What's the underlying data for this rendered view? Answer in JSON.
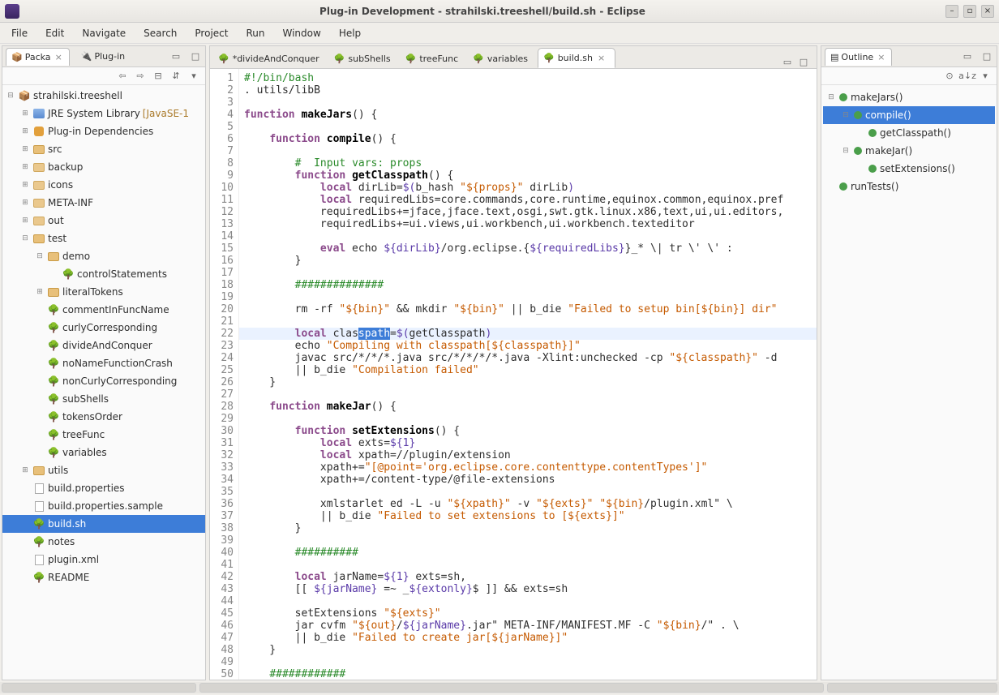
{
  "window": {
    "title": "Plug-in Development - strahilski.treeshell/build.sh - Eclipse"
  },
  "menu": [
    "File",
    "Edit",
    "Navigate",
    "Search",
    "Project",
    "Run",
    "Window",
    "Help"
  ],
  "leftTabs": [
    {
      "label": "Packa",
      "close": true
    },
    {
      "label": "Plug-in"
    }
  ],
  "project": {
    "name": "strahilski.treeshell",
    "nodes": [
      {
        "ind": 1,
        "tw": "⊞",
        "icon": "jre",
        "label": "JRE System Library",
        "suffix": "[JavaSE-1"
      },
      {
        "ind": 1,
        "tw": "⊞",
        "icon": "plug",
        "label": "Plug-in Dependencies"
      },
      {
        "ind": 1,
        "tw": "⊞",
        "icon": "folder",
        "label": "src"
      },
      {
        "ind": 1,
        "tw": "⊞",
        "icon": "folder-c",
        "label": "backup"
      },
      {
        "ind": 1,
        "tw": "⊞",
        "icon": "folder-c",
        "label": "icons"
      },
      {
        "ind": 1,
        "tw": "⊞",
        "icon": "folder-c",
        "label": "META-INF"
      },
      {
        "ind": 1,
        "tw": "⊞",
        "icon": "folder-c",
        "label": "out"
      },
      {
        "ind": 1,
        "tw": "⊟",
        "icon": "folder",
        "label": "test"
      },
      {
        "ind": 2,
        "tw": "⊟",
        "icon": "folder",
        "label": "demo"
      },
      {
        "ind": 3,
        "tw": "",
        "icon": "tree",
        "label": "controlStatements"
      },
      {
        "ind": 2,
        "tw": "⊞",
        "icon": "folder",
        "label": "literalTokens"
      },
      {
        "ind": 2,
        "tw": "",
        "icon": "tree",
        "label": "commentInFuncName"
      },
      {
        "ind": 2,
        "tw": "",
        "icon": "tree",
        "label": "curlyCorresponding"
      },
      {
        "ind": 2,
        "tw": "",
        "icon": "tree",
        "label": "divideAndConquer"
      },
      {
        "ind": 2,
        "tw": "",
        "icon": "tree",
        "label": "noNameFunctionCrash"
      },
      {
        "ind": 2,
        "tw": "",
        "icon": "tree",
        "label": "nonCurlyCorresponding"
      },
      {
        "ind": 2,
        "tw": "",
        "icon": "tree",
        "label": "subShells"
      },
      {
        "ind": 2,
        "tw": "",
        "icon": "tree",
        "label": "tokensOrder"
      },
      {
        "ind": 2,
        "tw": "",
        "icon": "tree",
        "label": "treeFunc"
      },
      {
        "ind": 2,
        "tw": "",
        "icon": "tree",
        "label": "variables"
      },
      {
        "ind": 1,
        "tw": "⊞",
        "icon": "folder",
        "label": "utils"
      },
      {
        "ind": 1,
        "tw": "",
        "icon": "file",
        "label": "build.properties"
      },
      {
        "ind": 1,
        "tw": "",
        "icon": "file",
        "label": "build.properties.sample"
      },
      {
        "ind": 1,
        "tw": "",
        "icon": "tree",
        "label": "build.sh",
        "selected": true
      },
      {
        "ind": 1,
        "tw": "",
        "icon": "tree",
        "label": "notes"
      },
      {
        "ind": 1,
        "tw": "",
        "icon": "file",
        "label": "plugin.xml"
      },
      {
        "ind": 1,
        "tw": "",
        "icon": "tree",
        "label": "README"
      }
    ]
  },
  "editorTabs": [
    {
      "label": "*divideAndConquer"
    },
    {
      "label": "subShells"
    },
    {
      "label": "treeFunc"
    },
    {
      "label": "variables"
    },
    {
      "label": "build.sh",
      "active": true,
      "x": true
    }
  ],
  "code": {
    "lines": [
      {
        "n": 1,
        "html": "<span class='cm'>#!/bin/bash</span>"
      },
      {
        "n": 2,
        "html": ". utils/libB"
      },
      {
        "n": 3,
        "html": ""
      },
      {
        "n": 4,
        "html": "<span class='kw'>function</span> <span class='id'>makeJars</span>() {"
      },
      {
        "n": 5,
        "html": ""
      },
      {
        "n": 6,
        "html": "    <span class='kw'>function</span> <span class='id'>compile</span>() {"
      },
      {
        "n": 7,
        "html": ""
      },
      {
        "n": 8,
        "html": "        <span class='cm'>#  Input vars: props</span>"
      },
      {
        "n": 9,
        "html": "        <span class='kw'>function</span> <span class='id'>getClasspath</span>() {"
      },
      {
        "n": 10,
        "html": "            <span class='kw'>local</span> dirLib=<span class='var'>$(</span>b_hash <span class='str'>\"${props}\"</span> dirLib<span class='var'>)</span>"
      },
      {
        "n": 11,
        "html": "            <span class='kw'>local</span> requiredLibs=core.commands,core.runtime,equinox.common,equinox.pref"
      },
      {
        "n": 12,
        "html": "            requiredLibs+=jface,jface.text,osgi,swt.gtk.linux.x86,text,ui,ui.editors,"
      },
      {
        "n": 13,
        "html": "            requiredLibs+=ui.views,ui.workbench,ui.workbench.texteditor"
      },
      {
        "n": 14,
        "html": ""
      },
      {
        "n": 15,
        "html": "            <span class='kw'>eval</span> echo <span class='var'>${dirLib}</span>/org.eclipse.{<span class='var'>${requiredLibs}</span>}_* \\| tr \\' \\' :"
      },
      {
        "n": 16,
        "html": "        }"
      },
      {
        "n": 17,
        "html": ""
      },
      {
        "n": 18,
        "html": "        <span class='cm'>##############</span>"
      },
      {
        "n": 19,
        "html": ""
      },
      {
        "n": 20,
        "html": "        rm -rf <span class='str'>\"${bin}\"</span> &amp;&amp; mkdir <span class='str'>\"${bin}\"</span> || b_die <span class='str'>\"Failed to setup bin[${bin}] dir\"</span>"
      },
      {
        "n": 21,
        "html": ""
      },
      {
        "n": 22,
        "hl": true,
        "html": "        <span class='kw'>local</span> clas<span class='sel'>spath</span>=<span class='var'>$(</span>getClasspath<span class='var'>)</span>"
      },
      {
        "n": 23,
        "html": "        echo <span class='str'>\"Compiling with classpath[${classpath}]\"</span>"
      },
      {
        "n": 24,
        "html": "        javac src/*/*/*.java src/*/*/*/*.java -Xlint:unchecked -cp <span class='str'>\"${classpath}\"</span> -d"
      },
      {
        "n": 25,
        "html": "        || b_die <span class='str'>\"Compilation failed\"</span>"
      },
      {
        "n": 26,
        "html": "    }"
      },
      {
        "n": 27,
        "html": ""
      },
      {
        "n": 28,
        "html": "    <span class='kw'>function</span> <span class='id'>makeJar</span>() {"
      },
      {
        "n": 29,
        "html": ""
      },
      {
        "n": 30,
        "html": "        <span class='kw'>function</span> <span class='id'>setExtensions</span>() {"
      },
      {
        "n": 31,
        "html": "            <span class='kw'>local</span> exts=<span class='var'>${1}</span>"
      },
      {
        "n": 32,
        "html": "            <span class='kw'>local</span> xpath=//plugin/extension"
      },
      {
        "n": 33,
        "html": "            xpath+=<span class='str'>\"[@point='org.eclipse.core.contenttype.contentTypes']\"</span>"
      },
      {
        "n": 34,
        "html": "            xpath+=/content-type/@file-extensions"
      },
      {
        "n": 35,
        "html": ""
      },
      {
        "n": 36,
        "html": "            xmlstarlet ed -L -u <span class='str'>\"${xpath}\"</span> -v <span class='str'>\"${exts}\"</span> <span class='str'>\"${bin}</span>/plugin.xml\" \\"
      },
      {
        "n": 37,
        "html": "            || b_die <span class='str'>\"Failed to set extensions to [${exts}]\"</span>"
      },
      {
        "n": 38,
        "html": "        }"
      },
      {
        "n": 39,
        "html": ""
      },
      {
        "n": 40,
        "html": "        <span class='cm'>##########</span>"
      },
      {
        "n": 41,
        "html": ""
      },
      {
        "n": 42,
        "html": "        <span class='kw'>local</span> jarName=<span class='var'>${1}</span> exts=sh,"
      },
      {
        "n": 43,
        "html": "        [[ <span class='var'>${jarName}</span> =~ _<span class='var'>${extonly}</span>$ ]] &amp;&amp; exts=sh"
      },
      {
        "n": 44,
        "html": ""
      },
      {
        "n": 45,
        "html": "        setExtensions <span class='str'>\"${exts}\"</span>"
      },
      {
        "n": 46,
        "html": "        jar cvfm <span class='str'>\"${out}</span>/<span class='var'>${jarName}</span>.jar\" META-INF/MANIFEST.MF -C <span class='str'>\"${bin}</span>/\" . \\"
      },
      {
        "n": 47,
        "html": "        || b_die <span class='str'>\"Failed to create jar[${jarName}]\"</span>"
      },
      {
        "n": 48,
        "html": "    }"
      },
      {
        "n": 49,
        "html": ""
      },
      {
        "n": 50,
        "html": "    <span class='cm'>############</span>"
      }
    ]
  },
  "outline": {
    "title": "Outline",
    "items": [
      {
        "ind": 0,
        "tw": "⊟",
        "label": "makeJars()"
      },
      {
        "ind": 1,
        "tw": "⊟",
        "label": "compile()",
        "selected": true
      },
      {
        "ind": 2,
        "tw": "",
        "label": "getClasspath()"
      },
      {
        "ind": 1,
        "tw": "⊟",
        "label": "makeJar()"
      },
      {
        "ind": 2,
        "tw": "",
        "label": "setExtensions()"
      },
      {
        "ind": 0,
        "tw": "",
        "label": "runTests()"
      }
    ]
  }
}
